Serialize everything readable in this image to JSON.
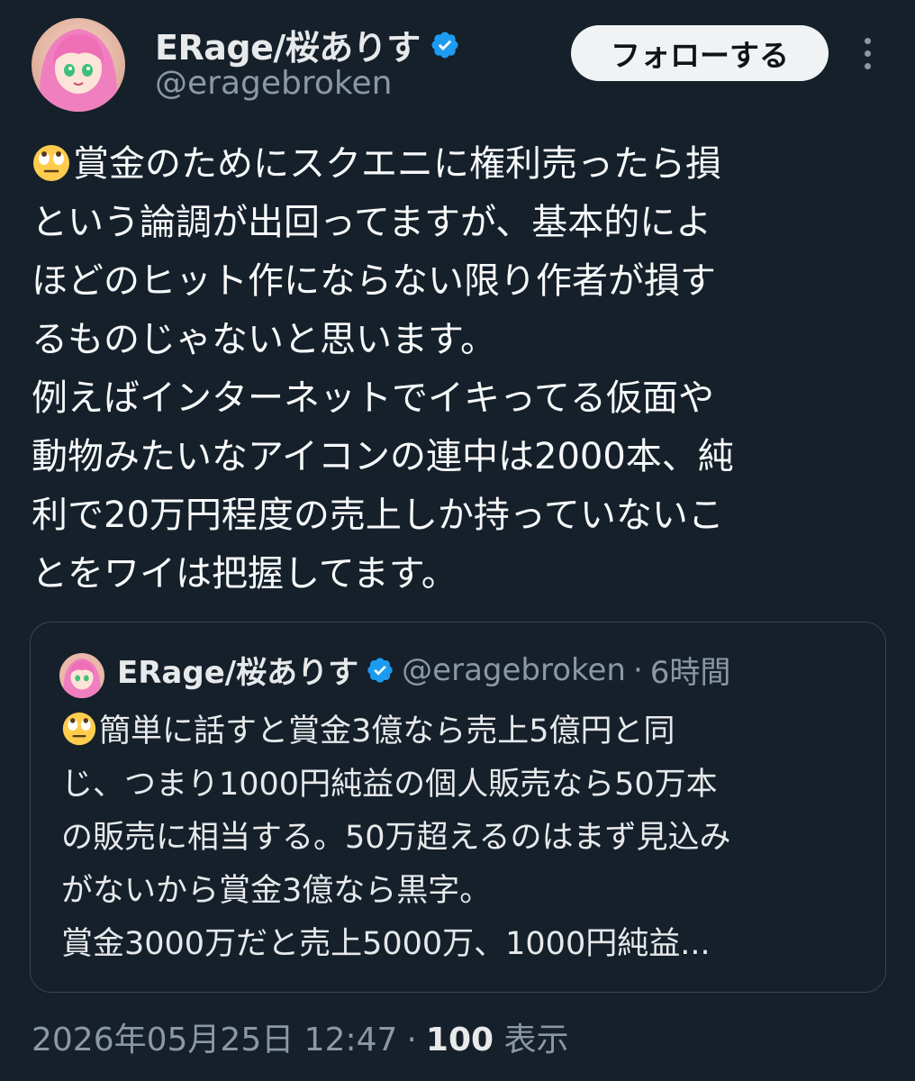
{
  "author": {
    "display_name": "ERage/桜ありす",
    "handle": "@eragebroken",
    "verified": true,
    "avatar_icon": "anime-girl-avatar"
  },
  "actions": {
    "follow_label": "フォローする",
    "more_icon": "more-vertical-icon"
  },
  "tweet": {
    "lines": [
      "賞金のためにスクエニに権利売ったら損",
      "という論調が出回ってますが、基本的によ",
      "ほどのヒット作にならない限り作者が損す",
      "るものじゃないと思います。",
      "例えばインターネットでイキってる仮面や",
      "動物みたいなアイコンの連中は2000本、純",
      "利で20万円程度の売上しか持っていないこ",
      "とをワイは把握してます。"
    ],
    "leading_emoji": "rolling-eyes-emoji"
  },
  "quote": {
    "display_name": "ERage/桜ありす",
    "handle": "@eragebroken",
    "separator": "·",
    "time_ago": "6時間",
    "lines": [
      "簡単に話すと賞金3億なら売上5億円と同",
      "じ、つまり1000円純益の個人販売なら50万本",
      "の販売に相当する。50万超えるのはまず見込み",
      "がないから賞金3億なら黒字。",
      "賞金3000万だと売上5000万、1000円純益..."
    ]
  },
  "meta": {
    "timestamp": "2026年05月25日 12:47",
    "separator": "·",
    "views_count": "100",
    "views_label": "表示"
  },
  "colors": {
    "background": "#15202b",
    "verified_blue": "#1d9bf0",
    "secondary_text": "#8b98a5",
    "border": "#38444d"
  }
}
